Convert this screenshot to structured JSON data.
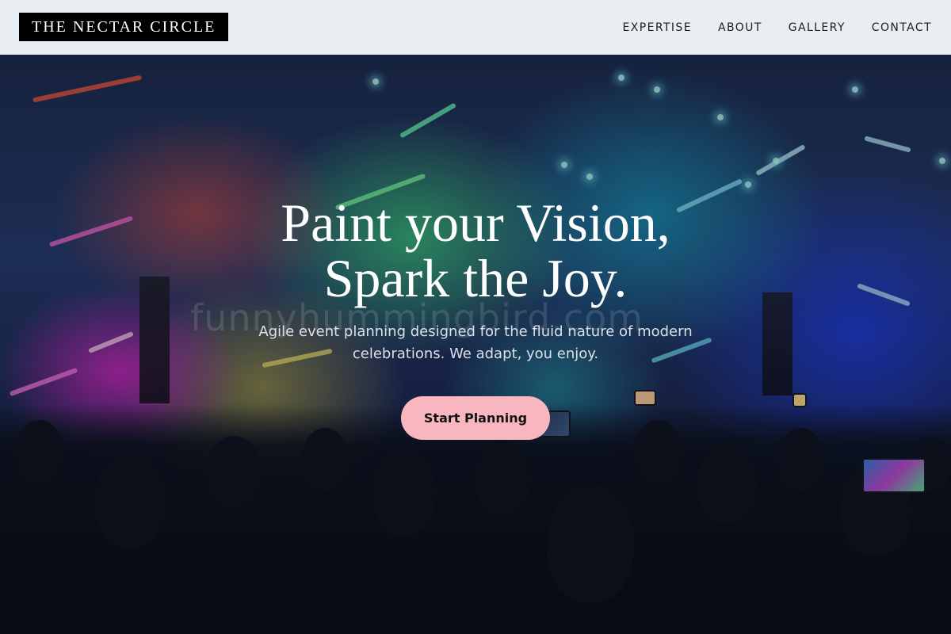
{
  "brand": {
    "name": "THE NECTAR CIRCLE"
  },
  "nav": {
    "items": [
      {
        "label": "EXPERTISE"
      },
      {
        "label": "ABOUT"
      },
      {
        "label": "GALLERY"
      },
      {
        "label": "CONTACT"
      }
    ]
  },
  "hero": {
    "headline_line1": "Paint your Vision,",
    "headline_line2": "Spark the Joy.",
    "subtitle": "Agile event planning designed for the fluid nature of modern celebrations. We adapt, you enjoy.",
    "cta_label": "Start Planning",
    "watermark": "funnyhummingbird.com"
  },
  "colors": {
    "header_bg": "#e9eef2",
    "logo_bg": "#000000",
    "cta_bg": "#f8b7bf",
    "headline_color": "#ffffff"
  }
}
